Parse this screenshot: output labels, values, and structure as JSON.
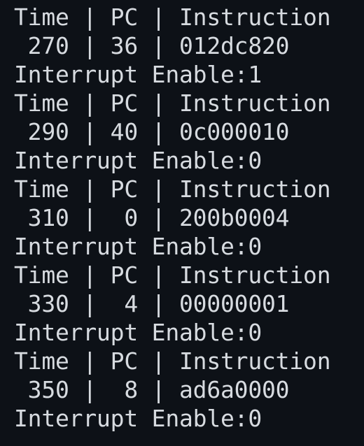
{
  "terminal": {
    "lines": [
      "Time | PC | Instruction",
      " 270 | 36 | 012dc820",
      "Interrupt Enable:1",
      "Time | PC | Instruction",
      " 290 | 40 | 0c000010",
      "Interrupt Enable:0",
      "Time | PC | Instruction",
      " 310 |  0 | 200b0004",
      "Interrupt Enable:0",
      "Time | PC | Instruction",
      " 330 |  4 | 00000001",
      "Interrupt Enable:0",
      "Time | PC | Instruction",
      " 350 |  8 | ad6a0000",
      "Interrupt Enable:0"
    ]
  },
  "colors": {
    "background": "#0d1117",
    "foreground": "#d7dbe0"
  }
}
